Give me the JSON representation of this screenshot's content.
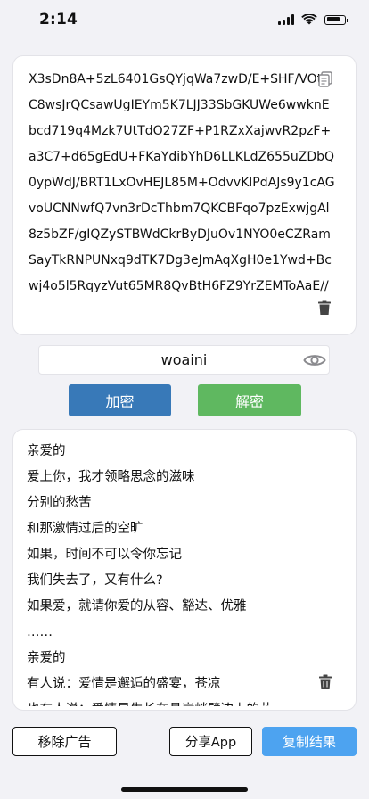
{
  "status_bar": {
    "time": "2:14",
    "icons": [
      "cellular-signal-icon",
      "wifi-icon",
      "battery-icon"
    ]
  },
  "ciphertext": {
    "value": "X3sDn8A+5zL6401GsQYjqWa7zwD/E+SHF/VOtdC8wsJrQCsawUgIEYm5K7LJJ33SbGKUWe6wwknEbcd719q4Mzk7UtTdO27ZF+P1RZxXajwvR2pzF+a3C7+d65gEdU+FKaYdibYhD6LLKLdZ655uZDbQ0ypWdJ/BRT1LxOvHEJL85M+OdvvKlPdAJs9y1cAGvoUCNNwfQ7vn3rDcThbm7QKCBFqo7pzExwjgAl8z5bZF/gIQZySTBWdCkrByDJuOv1NYO0eCZRamSayTkRNPUNxq9dTK7Dg3eJmAqXgH0e1Ywd+Bcwj4o5l5RqyzVut65MR8QvBtH6FZ9YrZEMToAaE//",
    "icons": [
      "copy-icon",
      "trash-icon"
    ]
  },
  "password": {
    "value": "woaini",
    "icon": "eye-icon"
  },
  "actions": {
    "encrypt_label": "加密",
    "decrypt_label": "解密"
  },
  "plaintext": {
    "lines": [
      "亲爱的",
      "爱上你，我才领略思念的滋味",
      "分别的愁苦",
      "和那激情过后的空旷",
      "如果，时间不可以令你忘记",
      "我们失去了，又有什么?",
      "如果爱，就请你爱的从容、豁达、优雅",
      "……",
      "亲爱的",
      "有人说：爱情是邂逅的盛宴，苍凉",
      "也有人说：爱情是生长在悬崖峭壁边上的花"
    ],
    "icon": "trash-icon"
  },
  "footer": {
    "remove_ad_label": "移除广告",
    "share_label": "分享App",
    "copy_result_label": "复制结果"
  },
  "colors": {
    "encrypt": "#3879b8",
    "decrypt": "#5fb860",
    "copy_result": "#4da3f0",
    "background": "#f2f2f6"
  }
}
